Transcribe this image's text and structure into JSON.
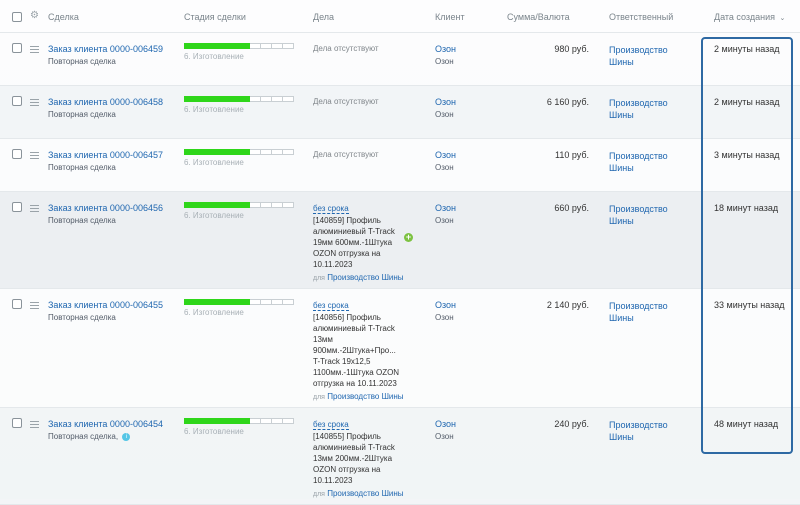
{
  "header": {
    "deal": "Сделка",
    "stage": "Стадия сделки",
    "activities": "Дела",
    "client": "Клиент",
    "sum": "Сумма/Валюта",
    "responsible": "Ответственный",
    "created": "Дата создания",
    "sort_icon": "chevron-down-icon"
  },
  "rows": [
    {
      "title": "Заказ клиента 0000-006459",
      "subtitle": "Повторная сделка",
      "stage_label": "6. Изготовление",
      "stage_progress": 0.6,
      "activity_none": "Дела отсутствуют",
      "client_link": "Озон",
      "client_sub": "Озон",
      "sum": "980 руб.",
      "responsible": "Производство Шины",
      "created": "2 минуты назад"
    },
    {
      "title": "Заказ клиента 0000-006458",
      "subtitle": "Повторная сделка",
      "stage_label": "6. Изготовление",
      "stage_progress": 0.6,
      "activity_none": "Дела отсутствуют",
      "client_link": "Озон",
      "client_sub": "Озон",
      "sum": "6 160 руб.",
      "responsible": "Производство Шины",
      "created": "2 минуты назад"
    },
    {
      "title": "Заказ клиента 0000-006457",
      "subtitle": "Повторная сделка",
      "stage_label": "6. Изготовление",
      "stage_progress": 0.6,
      "activity_none": "Дела отсутствуют",
      "client_link": "Озон",
      "client_sub": "Озон",
      "sum": "110 руб.",
      "responsible": "Производство Шины",
      "created": "3 минуты назад"
    },
    {
      "title": "Заказ клиента 0000-006456",
      "subtitle": "Повторная сделка",
      "stage_label": "6. Изготовление",
      "stage_progress": 0.6,
      "activity_due": "без срока",
      "activity_text": "[140859] Профиль алюминиевый T-Track 19мм 600мм.-1Штука OZON отгрузка на 10.11.2023",
      "activity_for_prefix": "для",
      "activity_for": "Производство Шины",
      "client_link": "Озон",
      "client_sub": "Озон",
      "sum": "660 руб.",
      "responsible": "Производство Шины",
      "created": "18 минут назад"
    },
    {
      "title": "Заказ клиента 0000-006455",
      "subtitle": "Повторная сделка",
      "stage_label": "6. Изготовление",
      "stage_progress": 0.6,
      "activity_due": "без срока",
      "activity_text": "[140856] Профиль алюминиевый T-Track 13мм 900мм.-2Штука+Про... T-Track 19x12,5 1100мм.-1Штука OZON отгрузка на 10.11.2023",
      "activity_for_prefix": "для",
      "activity_for": "Производство Шины",
      "client_link": "Озон",
      "client_sub": "Озон",
      "sum": "2 140 руб.",
      "responsible": "Производство Шины",
      "created": "33 минуты назад"
    },
    {
      "title": "Заказ клиента 0000-006454",
      "subtitle": "Повторная сделка,",
      "stage_label": "6. Изготовление",
      "stage_progress": 0.6,
      "activity_due": "без срока",
      "activity_text": "[140855] Профиль алюминиевый T-Track 13мм 200мм.-2Штука OZON отгрузка на 10.11.2023",
      "activity_for_prefix": "для",
      "activity_for": "Производство Шины",
      "client_link": "Озон",
      "client_sub": "Озон",
      "sum": "240 руб.",
      "responsible": "Производство Шины",
      "created": "48 минут назад"
    }
  ],
  "colors": {
    "link": "#2067b0",
    "stage_fill": "#2fd61a",
    "highlight_frame": "#2e69a3"
  }
}
